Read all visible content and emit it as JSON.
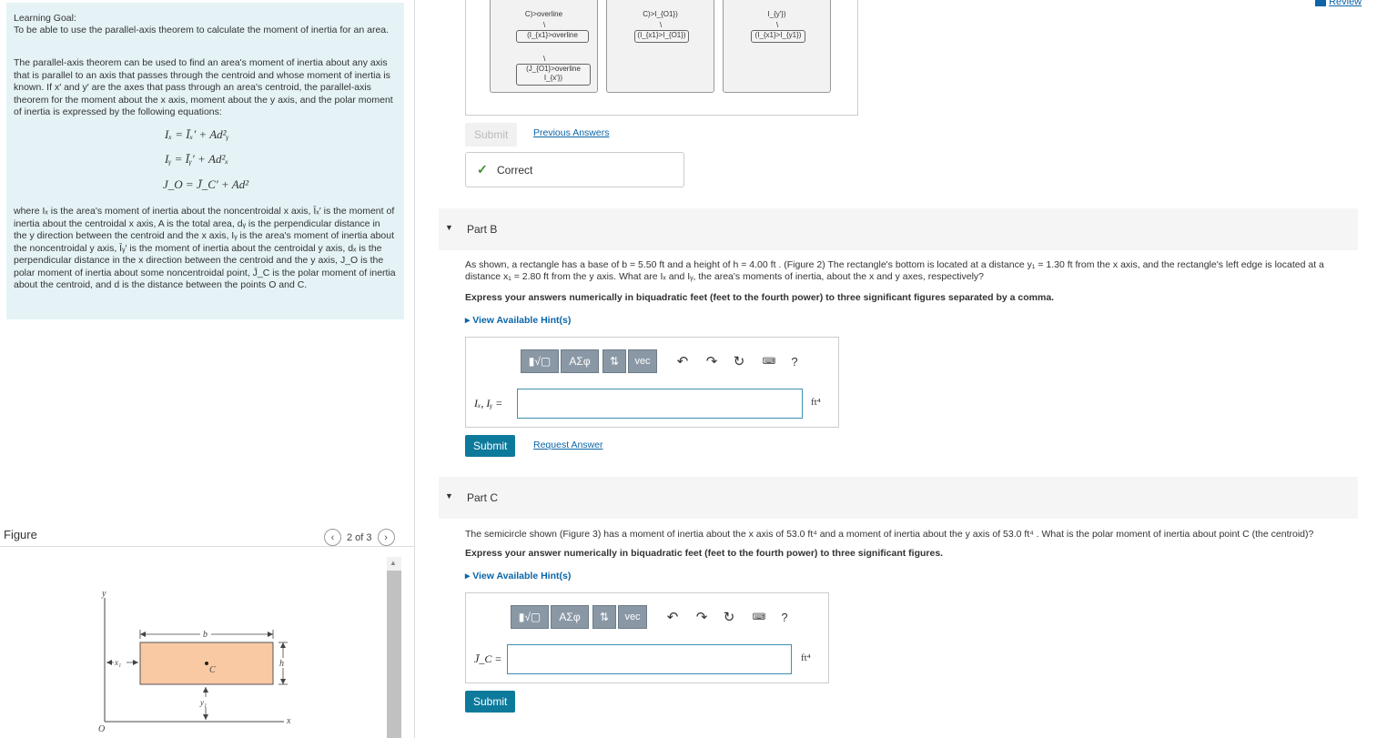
{
  "learning": {
    "heading": "Learning Goal:",
    "goal": "To be able to use the parallel-axis theorem to calculate the moment of inertia for an area.",
    "intro": "The parallel-axis theorem can be used to find an area's moment of inertia about any axis that is parallel to an axis that passes through the centroid and whose moment of inertia is known. If x′ and y′ are the axes that pass through an area's centroid, the parallel-axis theorem for the moment about the x axis, moment about the y axis, and the polar moment of inertia is expressed by the following equations:",
    "eq1": "Iₓ = Īₓ′ + Ad²ᵧ",
    "eq2": "Iᵧ = Īᵧ′ + Ad²ₓ",
    "eq3": "J_O = J̄_C′ + Ad²",
    "where": "where Iₓ is the area's moment of inertia about the noncentroidal x axis, Īₓ′ is the moment of inertia about the centroidal x axis, A is the total area, dᵧ is the perpendicular distance in the y direction between the centroid and the x axis, Iᵧ is the area's moment of inertia about the noncentroidal y axis, Īᵧ′ is the moment of inertia about the centroidal y axis, dₓ is the perpendicular distance in the x direction between the centroid and the y axis, J_O is the polar moment of inertia about some noncentroidal point, J̄_C is the polar moment of inertia about the centroid, and d is the distance between the points O and C."
  },
  "figure": {
    "title": "Figure",
    "pager": "2 of 3",
    "labels": {
      "y": "y",
      "x": "x",
      "o": "O",
      "b": "b",
      "h": "h",
      "c": "C",
      "x1": "x₁",
      "y1": "y₁"
    }
  },
  "review": "Review",
  "partA": {
    "tiles": [
      {
        "lines": [
          "C)>overline"
        ],
        "chips": [
          "(I_{x1}>overline",
          "(J_{O1}>overline I_{x'})"
        ]
      },
      {
        "lines": [
          "C)>I_{O1})"
        ],
        "chips": [
          "(I_{x1}>I_{O1})"
        ]
      },
      {
        "lines": [
          "I_{y'})"
        ],
        "chips": [
          "(I_{x1}>I_{y1})"
        ]
      }
    ],
    "submit": "Submit",
    "prev": "Previous Answers",
    "correct": "Correct"
  },
  "partB": {
    "label": "Part B",
    "question": "As shown, a rectangle has a base of b = 5.50 ft and a height of h = 4.00 ft . (Figure 2) The rectangle's bottom is located at a distance y₁ = 1.30 ft from the x axis, and the rectangle's left edge is located at a distance x₁ = 2.80 ft from the y axis. What are Iₓ and Iᵧ, the area's moments of inertia, about the x and y axes, respectively?",
    "instr": "Express your answers numerically in biquadratic feet (feet to the fourth power) to three significant figures separated by a comma.",
    "hint": "▸ View Available Hint(s)",
    "input_label": "Iₓ, Iᵧ =",
    "unit": "ft⁴",
    "submit": "Submit",
    "request": "Request Answer"
  },
  "partC": {
    "label": "Part C",
    "question": "The semicircle shown (Figure 3) has a moment of inertia about the x axis of 53.0 ft⁴ and a moment of inertia about the y axis of 53.0 ft⁴ . What is the polar moment of inertia about point C (the centroid)?",
    "instr": "Express your answer numerically in biquadratic feet (feet to the fourth power) to three significant figures.",
    "hint": "▸ View Available Hint(s)",
    "input_label": "J̄_C =",
    "unit": "ft⁴",
    "submit": "Submit"
  },
  "toolbar": {
    "templates": "▮√▢",
    "greek": "ΑΣφ",
    "arrows": "⇅",
    "vec": "vec",
    "help": "?"
  }
}
